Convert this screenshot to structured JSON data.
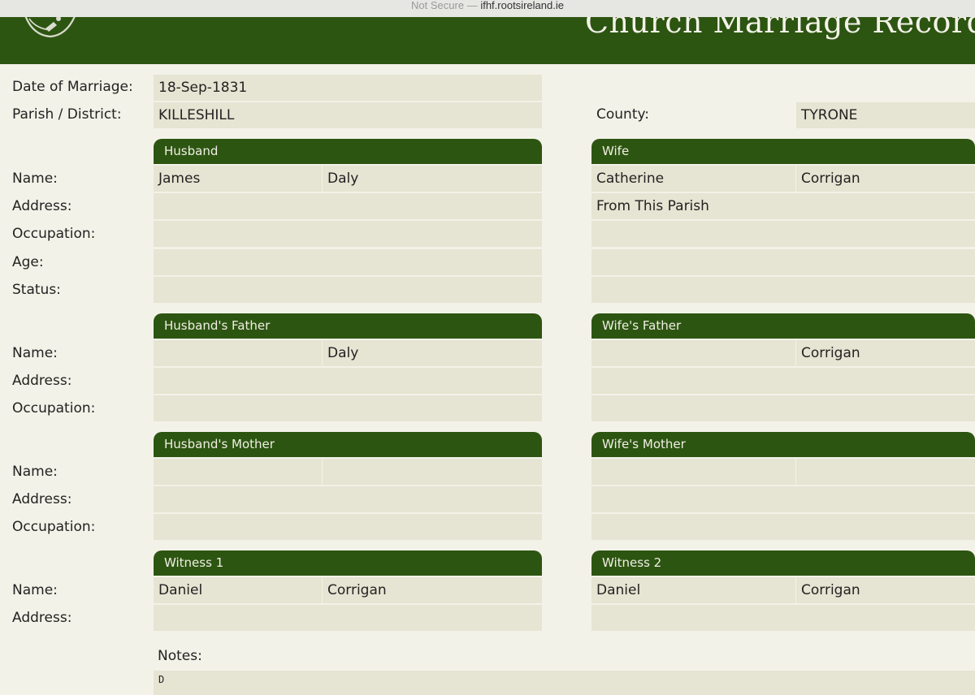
{
  "browser": {
    "security": "Not Secure",
    "separator": " — ",
    "host": "ifhf.rootsireland.ie"
  },
  "header": {
    "title": "Church Marriage Record"
  },
  "labels": {
    "date_of_marriage": "Date of Marriage:",
    "parish_district": "Parish / District:",
    "county": "County:",
    "name": "Name:",
    "address": "Address:",
    "occupation": "Occupation:",
    "age": "Age:",
    "status": "Status:",
    "notes": "Notes:"
  },
  "record": {
    "date_of_marriage": "18-Sep-1831",
    "parish_district": "KILLESHILL",
    "county": "TYRONE"
  },
  "sections": {
    "husband": {
      "title": "Husband",
      "first_name": "James",
      "surname": "Daly",
      "address": "",
      "occupation": "",
      "age": "",
      "status": ""
    },
    "wife": {
      "title": "Wife",
      "first_name": "Catherine",
      "surname": "Corrigan",
      "address": "From This Parish",
      "occupation": "",
      "age": "",
      "status": ""
    },
    "husbands_father": {
      "title": "Husband's Father",
      "first_name": "",
      "surname": "Daly",
      "address": "",
      "occupation": ""
    },
    "wifes_father": {
      "title": "Wife's Father",
      "first_name": "",
      "surname": "Corrigan",
      "address": "",
      "occupation": ""
    },
    "husbands_mother": {
      "title": "Husband's Mother",
      "first_name": "",
      "surname": "",
      "address": "",
      "occupation": ""
    },
    "wifes_mother": {
      "title": "Wife's Mother",
      "first_name": "",
      "surname": "",
      "address": "",
      "occupation": ""
    },
    "witness1": {
      "title": "Witness 1",
      "first_name": "Daniel",
      "surname": "Corrigan",
      "address": ""
    },
    "witness2": {
      "title": "Witness 2",
      "first_name": "Daniel",
      "surname": "Corrigan",
      "address": ""
    }
  },
  "notes": {
    "value": "D"
  },
  "colors": {
    "header_green": "#2d5512",
    "field_bg": "#e6e4d2",
    "page_bg": "#f3f2e8"
  },
  "icons": {
    "logo": "society-emblem"
  }
}
